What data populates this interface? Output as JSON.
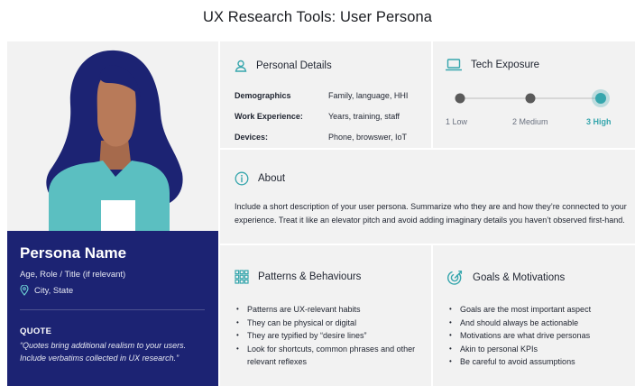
{
  "page_title": "UX Research Tools: User Persona",
  "colors": {
    "accent": "#36a6ad",
    "navy": "#1c2373",
    "panel_bg": "#f2f2f2",
    "teal_shirt": "#5bbfc1",
    "skin": "#b87a59"
  },
  "persona": {
    "name": "Persona Name",
    "role": "Age, Role / Title (if relevant)",
    "location": "City, State",
    "quote_label": "QUOTE",
    "quote": "“Quotes bring additional realism to your users. Include verbatims collected in UX research.”"
  },
  "personal_details": {
    "title": "Personal Details",
    "icon": "user-icon",
    "rows": [
      {
        "label": "Demographics",
        "value": "Family, language, HHI"
      },
      {
        "label": "Work Experience:",
        "value": "Years, training, staff"
      },
      {
        "label": "Devices:",
        "value": "Phone, browswer, IoT"
      }
    ]
  },
  "tech_exposure": {
    "title": "Tech Exposure",
    "icon": "laptop-icon",
    "levels": [
      "1 Low",
      "2 Medium",
      "3 High"
    ],
    "selected_index": 2
  },
  "about": {
    "title": "About",
    "icon": "info-icon",
    "text": "Include a short description of your user persona. Summarize who they are and how they’re connected to your experience. Treat it like an elevator pitch and avoid adding imaginary details you haven’t observed first-hand."
  },
  "patterns": {
    "title": "Patterns & Behaviours",
    "icon": "grid-icon",
    "items": [
      "Patterns are UX-relevant habits",
      "They can be physical or digital",
      "They are typified by “desire lines”",
      "Look for shortcuts, common phrases and other relevant reflexes"
    ]
  },
  "goals": {
    "title": "Goals & Motivations",
    "icon": "target-icon",
    "items": [
      "Goals are the most important aspect",
      "And should always be actionable",
      "Motivations are what drive personas",
      "Akin to personal KPIs",
      "Be careful to avoid assumptions"
    ]
  }
}
